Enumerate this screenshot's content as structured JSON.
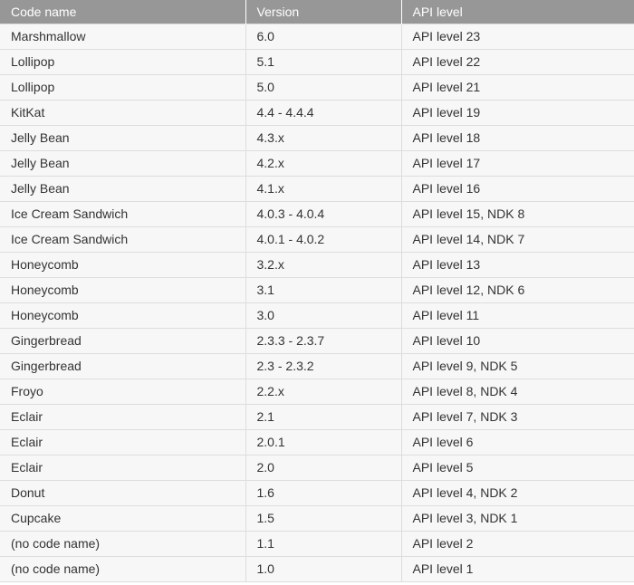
{
  "table": {
    "headers": [
      "Code name",
      "Version",
      "API level"
    ],
    "rows": [
      [
        "Marshmallow",
        "6.0",
        "API level 23"
      ],
      [
        "Lollipop",
        "5.1",
        "API level 22"
      ],
      [
        "Lollipop",
        "5.0",
        "API level 21"
      ],
      [
        "KitKat",
        "4.4 - 4.4.4",
        "API level 19"
      ],
      [
        "Jelly Bean",
        "4.3.x",
        "API level 18"
      ],
      [
        "Jelly Bean",
        "4.2.x",
        "API level 17"
      ],
      [
        "Jelly Bean",
        "4.1.x",
        "API level 16"
      ],
      [
        "Ice Cream Sandwich",
        "4.0.3 - 4.0.4",
        "API level 15, NDK 8"
      ],
      [
        "Ice Cream Sandwich",
        "4.0.1 - 4.0.2",
        "API level 14, NDK 7"
      ],
      [
        "Honeycomb",
        "3.2.x",
        "API level 13"
      ],
      [
        "Honeycomb",
        "3.1",
        "API level 12, NDK 6"
      ],
      [
        "Honeycomb",
        "3.0",
        "API level 11"
      ],
      [
        "Gingerbread",
        "2.3.3 - 2.3.7",
        "API level 10"
      ],
      [
        "Gingerbread",
        "2.3 - 2.3.2",
        "API level 9, NDK 5"
      ],
      [
        "Froyo",
        "2.2.x",
        "API level 8, NDK 4"
      ],
      [
        "Eclair",
        "2.1",
        "API level 7, NDK 3"
      ],
      [
        "Eclair",
        "2.0.1",
        "API level 6"
      ],
      [
        "Eclair",
        "2.0",
        "API level 5"
      ],
      [
        "Donut",
        "1.6",
        "API level 4, NDK 2"
      ],
      [
        "Cupcake",
        "1.5",
        "API level 3, NDK 1"
      ],
      [
        "(no code name)",
        "1.1",
        "API level 2"
      ],
      [
        "(no code name)",
        "1.0",
        "API level 1"
      ]
    ]
  },
  "colors": {
    "header_bg": "#979797",
    "header_text": "#ffffff",
    "row_bg": "#f7f7f7",
    "row_text": "#333333",
    "border": "#dddddd"
  }
}
